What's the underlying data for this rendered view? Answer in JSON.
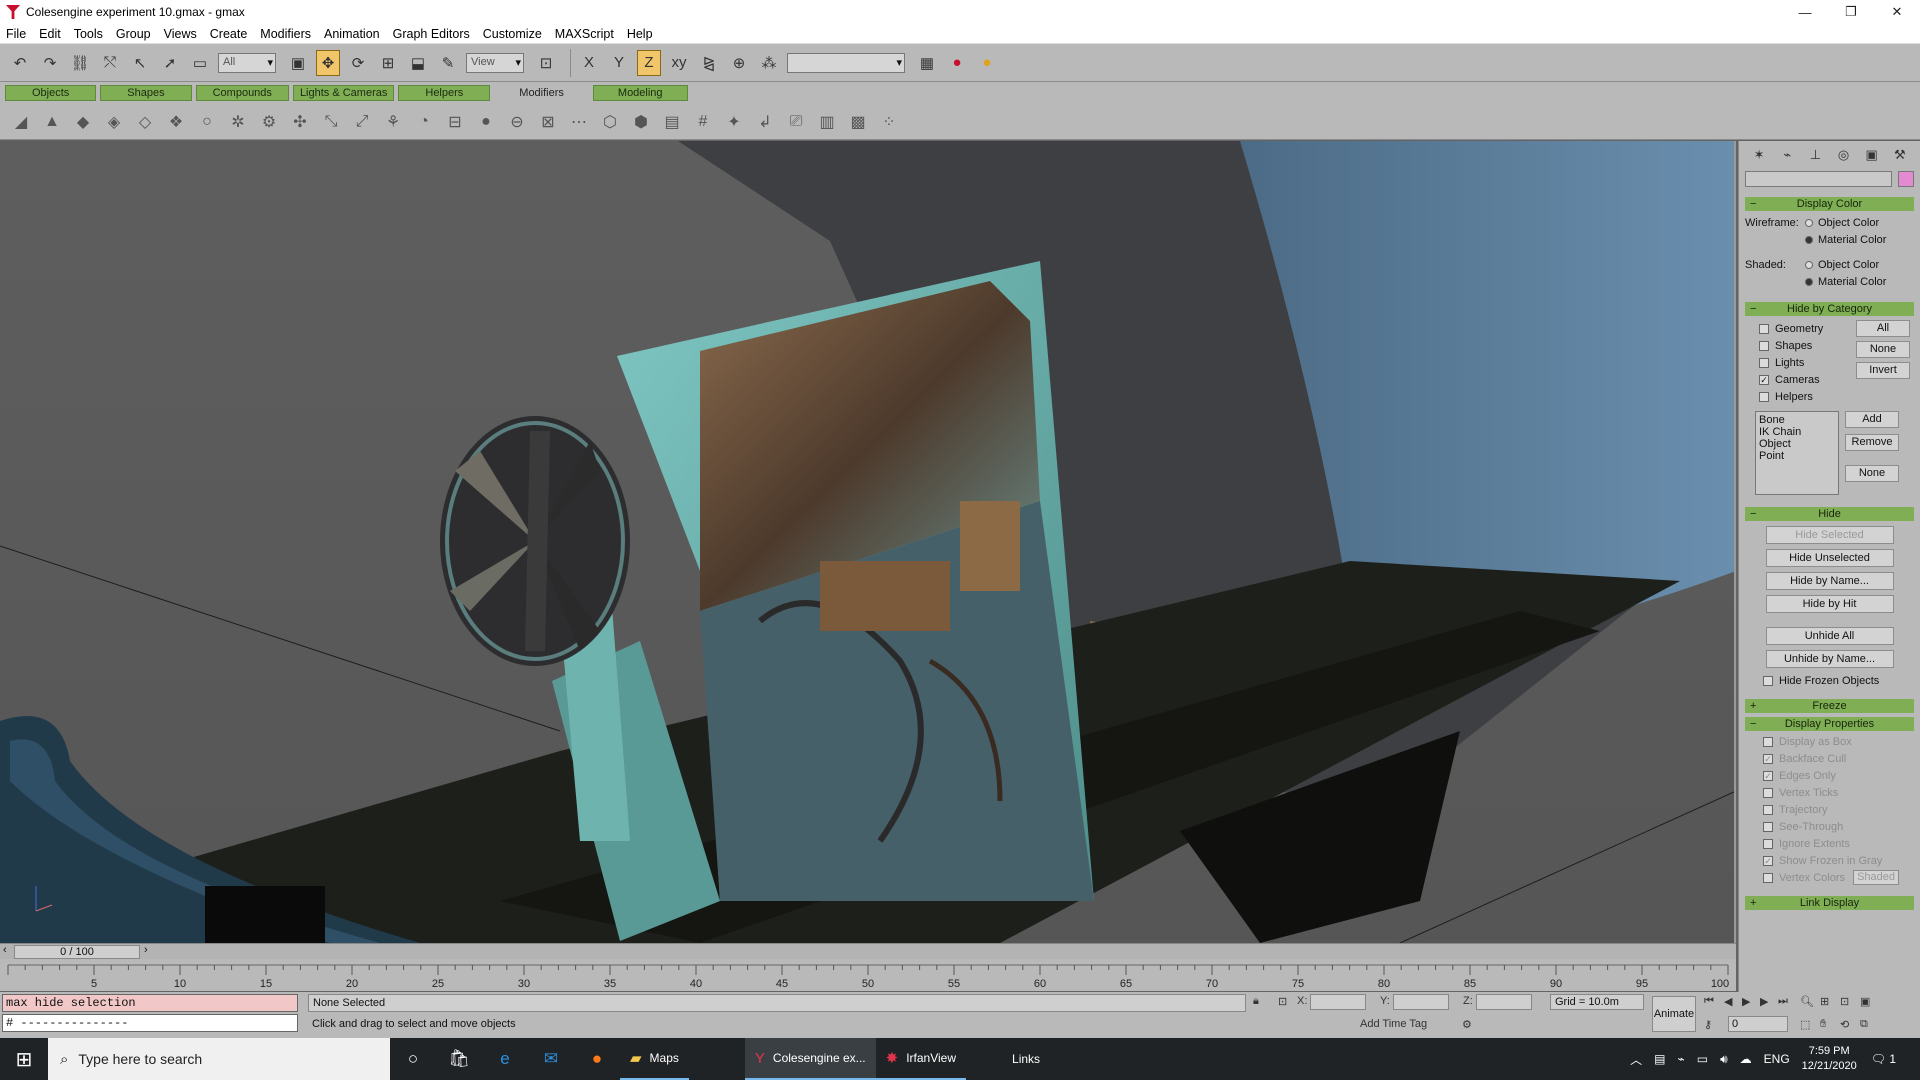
{
  "window": {
    "title": "Colesengine experiment 10.gmax - gmax",
    "min_label": "—",
    "max_label": "❐",
    "close_label": "✕"
  },
  "menu": [
    "File",
    "Edit",
    "Tools",
    "Group",
    "Views",
    "Create",
    "Modifiers",
    "Animation",
    "Graph Editors",
    "Customize",
    "MAXScript",
    "Help"
  ],
  "toolbar": {
    "selection_filter": "All",
    "coord_system": "View"
  },
  "tabs": [
    "Objects",
    "Shapes",
    "Compounds",
    "Lights & Cameras",
    "Helpers",
    "Modifiers",
    "Modeling"
  ],
  "command_panel": {
    "display_color": {
      "title": "Display Color",
      "wireframe_label": "Wireframe:",
      "shaded_label": "Shaded:",
      "object_color": "Object Color",
      "material_color": "Material Color"
    },
    "hide_by_category": {
      "title": "Hide by Category",
      "items": [
        "Geometry",
        "Shapes",
        "Lights",
        "Cameras",
        "Helpers"
      ],
      "checked": [
        false,
        false,
        false,
        true,
        false
      ],
      "buttons": [
        "All",
        "None",
        "Invert"
      ],
      "list": [
        "Bone",
        "IK Chain Object",
        "Point"
      ],
      "list_buttons": [
        "Add",
        "Remove",
        "None"
      ]
    },
    "hide": {
      "title": "Hide",
      "buttons": [
        "Hide Selected",
        "Hide Unselected",
        "Hide by Name...",
        "Hide by Hit",
        "Unhide All",
        "Unhide by Name..."
      ],
      "frozen": "Hide Frozen Objects"
    },
    "freeze_title": "Freeze",
    "display_properties": {
      "title": "Display Properties",
      "items": [
        "Display as Box",
        "Backface Cull",
        "Edges Only",
        "Vertex Ticks",
        "Trajectory",
        "See-Through",
        "Ignore Extents",
        "Show Frozen in Gray",
        "Vertex Colors"
      ],
      "checked": [
        false,
        true,
        true,
        false,
        false,
        false,
        false,
        true,
        false
      ],
      "shaded_btn": "Shaded"
    },
    "link_display_title": "Link Display"
  },
  "timeline": {
    "frame_label": "0 / 100",
    "ticks": [
      "5",
      "10",
      "15",
      "20",
      "25",
      "30",
      "35",
      "40",
      "45",
      "50",
      "55",
      "60",
      "65",
      "70",
      "75",
      "80",
      "85",
      "90",
      "95",
      "100"
    ]
  },
  "listener": {
    "line1": "max hide selection",
    "line2": "# ---------------"
  },
  "status": {
    "selection": "None Selected",
    "prompt": "Click and drag to select and move objects",
    "x_label": "X:",
    "y_label": "Y:",
    "z_label": "Z:",
    "grid": "Grid = 10.0m",
    "animate": "Animate",
    "add_time_tag": "Add Time Tag",
    "frame": "0"
  },
  "taskbar": {
    "search_placeholder": "Type here to search",
    "apps": [
      "Maps",
      "Colesengine ex...",
      "IrfanView",
      "Links"
    ],
    "language": "ENG",
    "time": "7:59 PM",
    "date": "12/21/2020",
    "notification_count": "1"
  }
}
